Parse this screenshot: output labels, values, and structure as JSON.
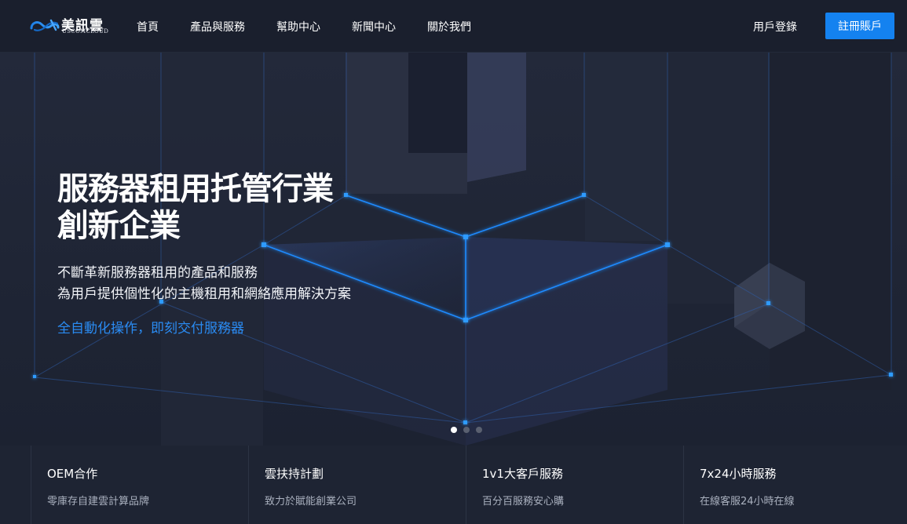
{
  "brand": {
    "name_cn": "美訊雲",
    "name_en": "USCOMCLOUD",
    "accent": "#1482f0"
  },
  "nav": {
    "items": [
      {
        "label": "首頁"
      },
      {
        "label": "產品與服務"
      },
      {
        "label": "幫助中心"
      },
      {
        "label": "新聞中心"
      },
      {
        "label": "關於我們"
      }
    ],
    "login_label": "用戶登錄",
    "register_label": "註冊賬戶"
  },
  "hero": {
    "title_line1": "服務器租用托管行業",
    "title_line2": "創新企業",
    "sub_line1": "不斷革新服務器租用的產品和服務",
    "sub_line2": "為用戶提供個性化的主機租用和網絡應用解決方案",
    "highlight": "全自動化操作，即刻交付服務器",
    "highlight_color": "#2a8bf2",
    "carousel": {
      "slides": 3,
      "active_index": 0
    }
  },
  "features": [
    {
      "title": "OEM合作",
      "desc": "零庫存自建雲計算品牌"
    },
    {
      "title": "雲扶持計劃",
      "desc": "致力於賦能創業公司"
    },
    {
      "title": "1v1大客戶服務",
      "desc": "百分百服務安心購"
    },
    {
      "title": "7x24小時服務",
      "desc": "在線客服24小時在線"
    }
  ]
}
